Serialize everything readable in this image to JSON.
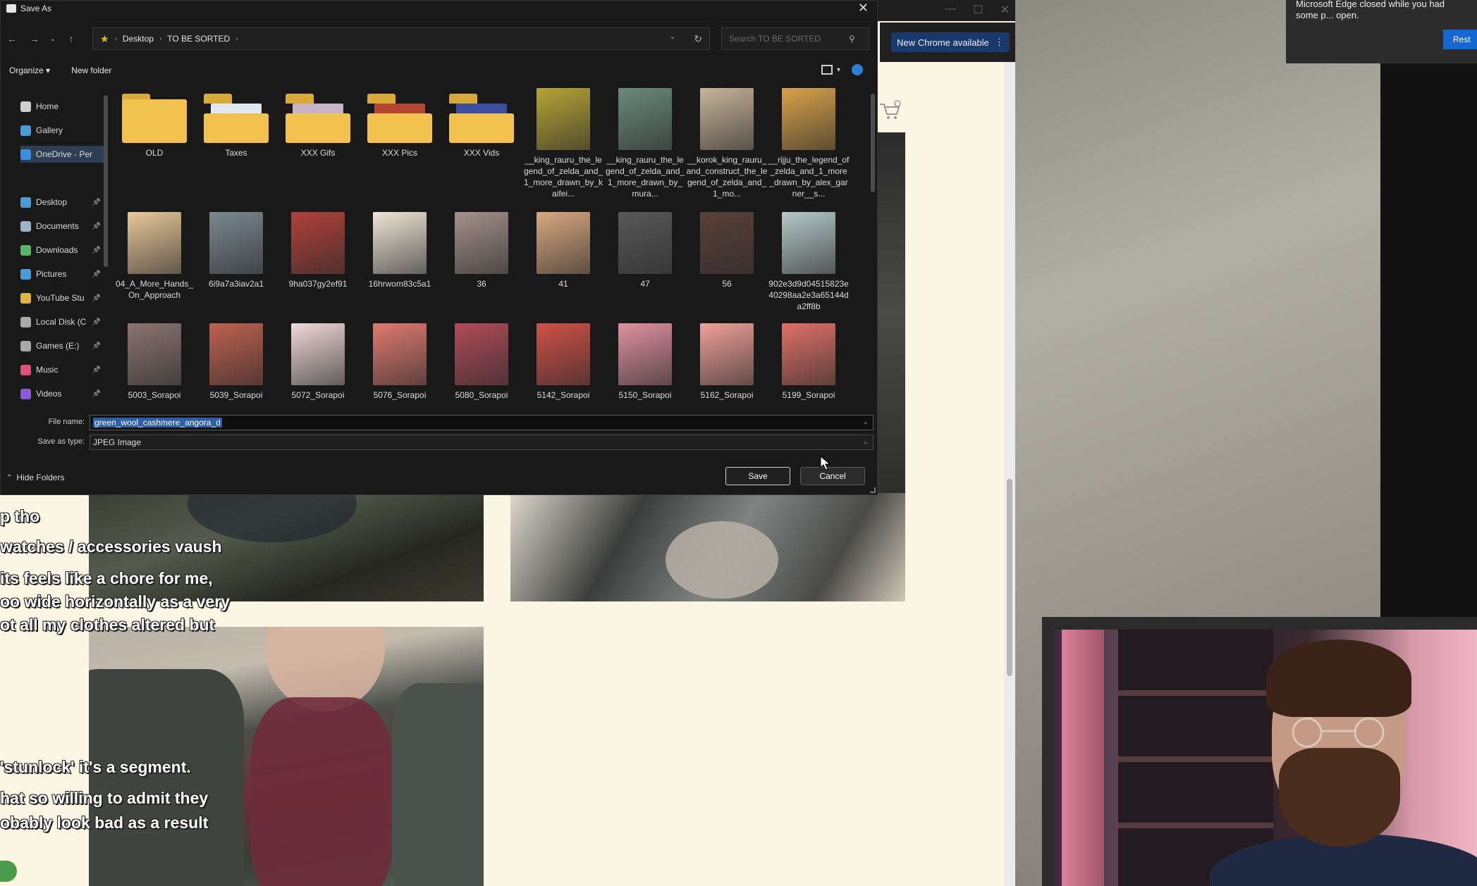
{
  "dialog": {
    "title": "Save As",
    "close_glyph": "✕",
    "breadcrumb": [
      "Desktop",
      "TO BE SORTED"
    ],
    "search_placeholder": "Search TO BE SORTED",
    "organize_label": "Organize ▾",
    "new_folder_label": "New folder",
    "file_name_label": "File name:",
    "file_name_value": "green_wool_cashmere_angora_d",
    "save_as_type_label": "Save as type:",
    "save_as_type_value": "JPEG Image",
    "hide_folders_label": "Hide Folders",
    "save_label": "Save",
    "cancel_label": "Cancel"
  },
  "nav_pane": {
    "items": [
      {
        "label": "Home",
        "icon": "home-icon",
        "color": "#cfcfcf"
      },
      {
        "label": "Gallery",
        "icon": "gallery-icon",
        "color": "#4a9ad8"
      },
      {
        "label": "OneDrive - Per",
        "icon": "onedrive-icon",
        "color": "#3c8ee0"
      },
      {
        "label": "Desktop",
        "icon": "desktop-icon",
        "color": "#4a9ad8"
      },
      {
        "label": "Documents",
        "icon": "documents-icon",
        "color": "#9fb3c8"
      },
      {
        "label": "Downloads",
        "icon": "downloads-icon",
        "color": "#58b36b"
      },
      {
        "label": "Pictures",
        "icon": "pictures-icon",
        "color": "#4a9ad8"
      },
      {
        "label": "YouTube Stu",
        "icon": "folder-icon",
        "color": "#e0b43e"
      },
      {
        "label": "Local Disk (C",
        "icon": "drive-icon",
        "color": "#a8a8a8"
      },
      {
        "label": "Games (E:)",
        "icon": "drive-icon",
        "color": "#a8a8a8"
      },
      {
        "label": "Music",
        "icon": "music-icon",
        "color": "#e0517a"
      },
      {
        "label": "Videos",
        "icon": "videos-icon",
        "color": "#8a5ad8"
      }
    ]
  },
  "files": [
    {
      "label": "OLD",
      "kind": "folder",
      "peek": ""
    },
    {
      "label": "Taxes",
      "kind": "folder",
      "peek": "#dfe7f0"
    },
    {
      "label": "XXX Gifs",
      "kind": "folder",
      "peek": "#c9b3c6"
    },
    {
      "label": "XXX Pics",
      "kind": "folder",
      "peek": "#b5462f"
    },
    {
      "label": "XXX Vids",
      "kind": "folder",
      "peek": "#3c4ea0"
    },
    {
      "label": "__king_rauru_the_legend_of_zelda_and_1_more_drawn_by_kaifei...",
      "kind": "image",
      "color": "#b6a436"
    },
    {
      "label": "__king_rauru_the_legend_of_zelda_and_1_more_drawn_by_mura...",
      "kind": "image",
      "color": "#6a8a7a"
    },
    {
      "label": "__korok_king_rauru_and_construct_the_legend_of_zelda_and_1_mo...",
      "kind": "image",
      "color": "#c7b49a"
    },
    {
      "label": "__rijju_the_legend_of_zelda_and_1_more_drawn_by_alex_garner__s...",
      "kind": "image",
      "color": "#d9a24a"
    },
    {
      "label": "04_A_More_Hands_On_Approach",
      "kind": "image",
      "color": "#e8c89a"
    },
    {
      "label": "6i9a7a3iav2a1",
      "kind": "image",
      "color": "#7a8890"
    },
    {
      "label": "9ha037gy2ef91",
      "kind": "image",
      "color": "#b0403a"
    },
    {
      "label": "16hrwom83c5a1",
      "kind": "image",
      "color": "#efe6d6"
    },
    {
      "label": "36",
      "kind": "image",
      "color": "#a4908a"
    },
    {
      "label": "41",
      "kind": "image",
      "color": "#d9a880"
    },
    {
      "label": "47",
      "kind": "image",
      "color": "#585858"
    },
    {
      "label": "56",
      "kind": "image",
      "color": "#5a4038"
    },
    {
      "label": "902e3d9d04515823e40298aa2e3a65144da2ff8b",
      "kind": "image",
      "color": "#b4c8c8"
    },
    {
      "label": "5003_Sorapoi",
      "kind": "image",
      "color": "#8a7470"
    },
    {
      "label": "5039_Sorapoi",
      "kind": "image",
      "color": "#c06050"
    },
    {
      "label": "5072_Sorapoi",
      "kind": "image",
      "color": "#f0d8d8"
    },
    {
      "label": "5076_Sorapoi",
      "kind": "image",
      "color": "#e07a70"
    },
    {
      "label": "5080_Sorapoi",
      "kind": "image",
      "color": "#b04a58"
    },
    {
      "label": "5142_Sorapoi",
      "kind": "image",
      "color": "#d05048"
    },
    {
      "label": "5150_Sorapoi",
      "kind": "image",
      "color": "#e090a0"
    },
    {
      "label": "5162_Sorapoi",
      "kind": "image",
      "color": "#f0a098"
    },
    {
      "label": "5199_Sorapoi",
      "kind": "image",
      "color": "#e07068"
    }
  ],
  "browser": {
    "new_chrome_label": "New Chrome available",
    "captions": [
      "p tho",
      "watches / accessories vaush",
      "its feels like a chore for me,",
      "oo wide horizontally as a very",
      "ot all my clothes altered but",
      "'stunlock' it's a segment.",
      "hat so willing to admit they",
      "obably look bad as a result"
    ]
  },
  "edge_toast": {
    "text": "Microsoft Edge closed while you had some p... open.",
    "button_label": "Rest"
  }
}
